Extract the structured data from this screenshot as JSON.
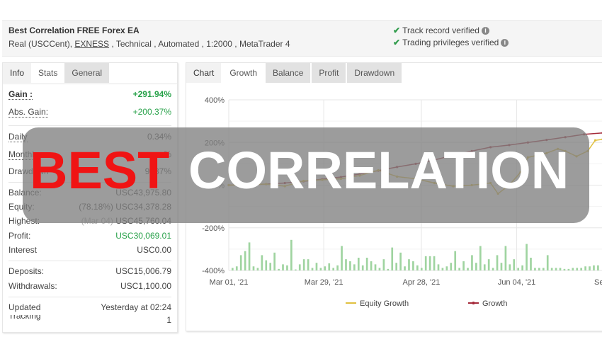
{
  "header": {
    "title": "Best Correlation FREE Forex EA",
    "subtitle_prefix": "Real (USCCent), ",
    "broker_link": "EXNESS",
    "subtitle_suffix": " , Technical , Automated , 1:2000 , MetaTrader 4",
    "verifications": [
      {
        "label": "Track record verified",
        "icon": "check-icon"
      },
      {
        "label": "Trading privileges verified",
        "icon": "check-icon"
      }
    ],
    "verified_color": "#2e9b4a"
  },
  "left_panel": {
    "tabs": [
      {
        "label": "Info",
        "state": "normal"
      },
      {
        "label": "Stats",
        "state": "active"
      },
      {
        "label": "General",
        "state": "normal"
      }
    ],
    "stats": {
      "gain": {
        "label": "Gain :",
        "value": "+291.94%"
      },
      "abs_gain": {
        "label": "Abs. Gain:",
        "value": "+200.37%"
      },
      "daily": {
        "label": "Daily",
        "value": "0.34%"
      },
      "monthly": {
        "label": "Monthly",
        "value": "%"
      },
      "drawdown": {
        "label": "Drawdown",
        "value": "9 .37%"
      },
      "balance": {
        "label": "Balance:",
        "value": "USC43,975.80"
      },
      "equity": {
        "label": "Equity:",
        "note": "(78.18%)",
        "value": "USC34,378.28"
      },
      "highest": {
        "label": "Highest:",
        "note": "(Mar 04)",
        "value": "USC45,760.04"
      },
      "profit": {
        "label": "Profit:",
        "value": "USC30,069.01"
      },
      "interest": {
        "label": "Interest",
        "value": "USC0.00"
      },
      "deposits": {
        "label": "Deposits:",
        "value": "USC15,006.79"
      },
      "withdrawals": {
        "label": "Withdrawals:",
        "value": "USC1,100.00"
      },
      "updated": {
        "label": "Updated",
        "value": "Yesterday at 02:24"
      },
      "tracking": {
        "label": "Tracking",
        "value": "1"
      }
    },
    "positive_color": "#27a149"
  },
  "right_panel": {
    "tabs": [
      {
        "label": "Chart",
        "state": "normal"
      },
      {
        "label": "Growth",
        "state": "active"
      },
      {
        "label": "Balance",
        "state": "normal"
      },
      {
        "label": "Profit",
        "state": "normal"
      },
      {
        "label": "Drawdown",
        "state": "normal"
      }
    ]
  },
  "overlay": {
    "word1": "BEST",
    "word2": "CORRELATION",
    "word1_color": "#f01414",
    "word2_color": "#ffffff"
  },
  "chart_data": {
    "type": "line",
    "title": "",
    "xlabel": "",
    "ylabel": "",
    "ylim": [
      -400,
      400
    ],
    "yticks": [
      "400%",
      "200%",
      "0%",
      "-200%",
      "-400%"
    ],
    "ytick_values": [
      400,
      200,
      0,
      -200,
      -400
    ],
    "xticks": [
      "Mar 01, '21",
      "Mar 29, '21",
      "Apr 28, '21",
      "Jun 04, '21",
      "Se"
    ],
    "x_range": [
      0,
      100
    ],
    "xtick_positions": [
      0,
      25.4,
      51.5,
      77,
      100
    ],
    "grid": true,
    "legend": {
      "position": "bottom",
      "entries": [
        "Equity Growth",
        "Growth"
      ]
    },
    "series": [
      {
        "name": "Growth",
        "color": "#a52a3a",
        "x": [
          0,
          5,
          10,
          15,
          20,
          25,
          30,
          35,
          40,
          45,
          50,
          55,
          60,
          65,
          70,
          75,
          80,
          85,
          90,
          95,
          100
        ],
        "values": [
          0,
          2,
          5,
          10,
          18,
          28,
          38,
          52,
          68,
          85,
          100,
          118,
          140,
          160,
          178,
          188,
          200,
          212,
          225,
          238,
          245
        ]
      },
      {
        "name": "Equity Growth",
        "color": "#e0c040",
        "x": [
          0,
          5,
          10,
          15,
          20,
          25,
          30,
          35,
          40,
          45,
          50,
          55,
          60,
          65,
          70,
          72,
          75,
          78,
          80,
          85,
          88,
          90,
          93,
          96,
          98,
          100
        ],
        "values": [
          0,
          2,
          5,
          -5,
          20,
          25,
          30,
          45,
          70,
          40,
          30,
          10,
          -5,
          0,
          10,
          -40,
          0,
          60,
          130,
          150,
          170,
          160,
          135,
          160,
          210,
          215
        ]
      },
      {
        "name": "Daily Volume",
        "type": "bar",
        "color": "#9fd4a0",
        "values": [
          5,
          8,
          30,
          38,
          55,
          8,
          5,
          30,
          20,
          15,
          35,
          3,
          12,
          10,
          60,
          2,
          12,
          22,
          22,
          5,
          15,
          5,
          8,
          14,
          5,
          10,
          48,
          22,
          18,
          12,
          25,
          10,
          25,
          18,
          12,
          5,
          22,
          3,
          45,
          15,
          35,
          8,
          22,
          18,
          10,
          5,
          28,
          28,
          28,
          12,
          5,
          8,
          15,
          38,
          5,
          18,
          5,
          30,
          15,
          48,
          12,
          22,
          5,
          30,
          15,
          48,
          12,
          22,
          5,
          10,
          52,
          25,
          5,
          5,
          5,
          30,
          5,
          5,
          5,
          3,
          3,
          5,
          5,
          5,
          8,
          8,
          10,
          10
        ]
      }
    ]
  }
}
